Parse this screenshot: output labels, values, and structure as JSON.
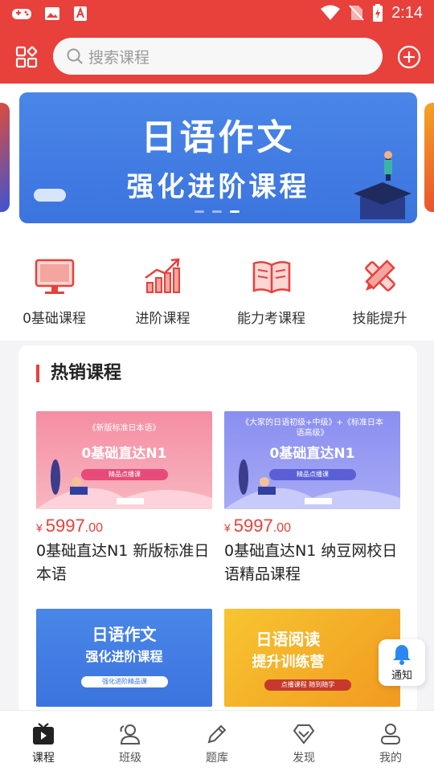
{
  "status_bar": {
    "time": "2:14"
  },
  "header": {
    "search_placeholder": "搜索课程"
  },
  "banner": {
    "title": "日语作文",
    "subtitle": "强化进阶课程"
  },
  "categories": [
    {
      "label": "0基础课程",
      "icon": "monitor-icon"
    },
    {
      "label": "进阶课程",
      "icon": "growth-chart-icon"
    },
    {
      "label": "能力考课程",
      "icon": "book-icon"
    },
    {
      "label": "技能提升",
      "icon": "pencil-ruler-icon"
    }
  ],
  "hot_section": {
    "title": "热销课程",
    "courses": [
      {
        "thumb_small": "《新版标准日本语》",
        "thumb_big": "0基础直达N1",
        "thumb_pill": "精品点播课",
        "price_symbol": "¥",
        "price_int": "5997",
        "price_dec": ".00",
        "name": "0基础直达N1 新版标准日本语"
      },
      {
        "thumb_small": "《大家的日语初级+中级》+《标准日本语高级》",
        "thumb_big": "0基础直达N1",
        "thumb_pill": "精品点播课",
        "price_symbol": "¥",
        "price_int": "5997",
        "price_dec": ".00",
        "name": "0基础直达N1 纳豆网校日语精品课程"
      },
      {
        "thumb_big": "日语作文",
        "thumb_big2": "强化进阶课程",
        "thumb_pill": "强化进阶精品课"
      },
      {
        "thumb_big": "日语阅读",
        "thumb_big2": "提升训练营",
        "thumb_pill": "点播课程  随到随学"
      }
    ]
  },
  "notify": {
    "label": "通知"
  },
  "tabs": [
    {
      "label": "课程",
      "icon": "tv-icon",
      "active": true
    },
    {
      "label": "班级",
      "icon": "people-icon",
      "active": false
    },
    {
      "label": "题库",
      "icon": "pencil-icon",
      "active": false
    },
    {
      "label": "发现",
      "icon": "diamond-icon",
      "active": false
    },
    {
      "label": "我的",
      "icon": "person-icon",
      "active": false
    }
  ],
  "colors": {
    "primary": "#e8403b",
    "price": "#e8403b"
  }
}
